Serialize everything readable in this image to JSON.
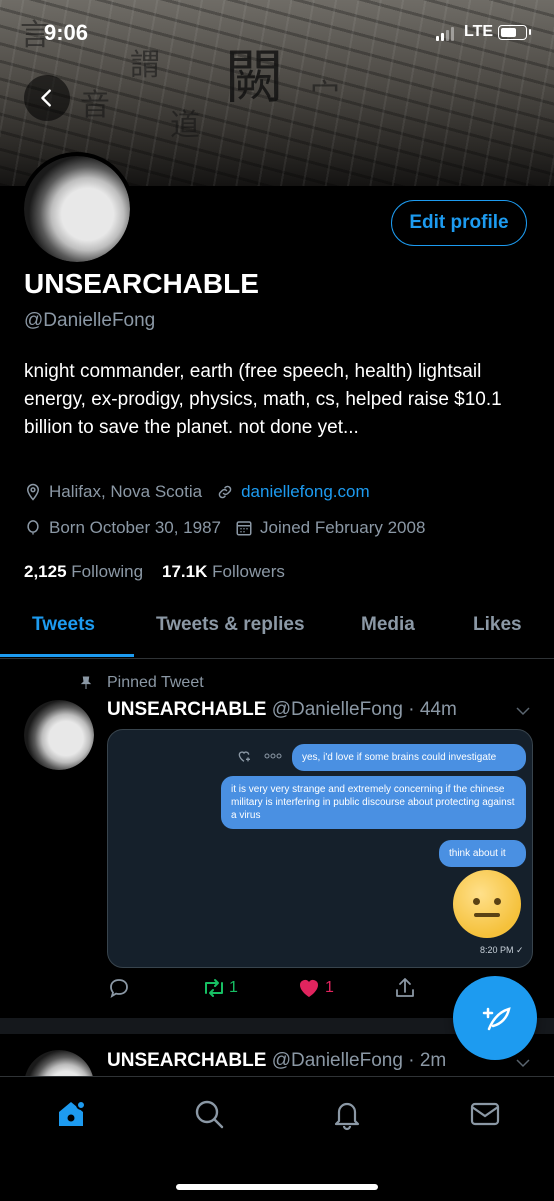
{
  "status_bar": {
    "time": "9:06",
    "carrier": "LTE",
    "battery_level": 0.75
  },
  "banner": {
    "glyphs": [
      "闕",
      "言",
      "謂",
      "宀",
      "道",
      "音"
    ]
  },
  "profile": {
    "edit_label": "Edit profile",
    "display_name": "UNSEARCHABLE",
    "handle": "@DanielleFong",
    "bio": "knight commander, earth (free speech, health) lightsail energy, ex-prodigy, physics, math, cs, helped raise $10.1 billion to save the planet. not done yet...",
    "location": "Halifax, Nova Scotia",
    "website": "daniellefong.com",
    "born": "Born October 30, 1987",
    "joined": "Joined February 2008",
    "following_count": "2,125",
    "following_label": "Following",
    "followers_count": "17.1K",
    "followers_label": "Followers"
  },
  "tabs": [
    {
      "label": "Tweets",
      "active": true
    },
    {
      "label": "Tweets & replies",
      "active": false
    },
    {
      "label": "Media",
      "active": false
    },
    {
      "label": "Likes",
      "active": false
    }
  ],
  "pinned_label": "Pinned Tweet",
  "tweet1": {
    "name": "UNSEARCHABLE",
    "handle_time": "@DanielleFong · 44m",
    "chat": {
      "msg1": "yes, i'd love if some brains could investigate",
      "msg2": "it is very very strange and extremely concerning if the chinese military is interfering in public discourse about protecting against a virus",
      "msg3": "think about it",
      "time": "8:20 PM ✓"
    },
    "retweets": "1",
    "likes": "1"
  },
  "tweet2": {
    "name": "UNSEARCHABLE",
    "handle_time": "@DanielleFong · 2m"
  },
  "colors": {
    "accent": "#1d9bf0",
    "retweet": "#17bf63",
    "like": "#e0245e",
    "muted": "#8b98a5"
  }
}
